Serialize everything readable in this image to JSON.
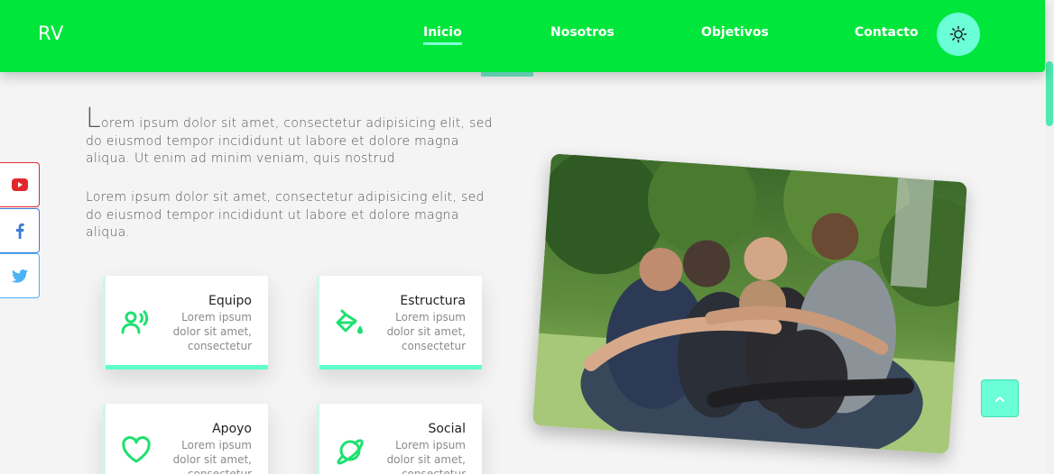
{
  "header": {
    "logo": "RV",
    "nav": [
      {
        "label": "Inicio",
        "active": true
      },
      {
        "label": "Nosotros",
        "active": false
      },
      {
        "label": "Objetivos",
        "active": false
      },
      {
        "label": "Contacto",
        "active": false
      }
    ],
    "theme_toggle_icon": "sun-icon"
  },
  "social": [
    {
      "icon": "youtube-icon",
      "color": "#e2282c"
    },
    {
      "icon": "facebook-icon",
      "color": "#3b7bd6"
    },
    {
      "icon": "twitter-icon",
      "color": "#4ab3f4"
    }
  ],
  "intro": {
    "dropcap": "L",
    "paragraph1_rest": "orem ipsum dolor sit amet, consectetur adipisicing elit, sed do eiusmod tempor incididunt ut labore et dolore magna aliqua. Ut enim ad minim veniam, quis nostrud",
    "paragraph2": "Lorem ipsum dolor sit amet, consectetur adipisicing elit, sed do eiusmod tempor incididunt ut labore et dolore magna aliqua."
  },
  "cards": [
    {
      "title": "Equipo",
      "desc": "Lorem ipsum dolor sit amet, consectetur",
      "icon": "team-icon"
    },
    {
      "title": "Estructura",
      "desc": "Lorem ipsum dolor sit amet, consectetur",
      "icon": "paint-bucket-icon"
    },
    {
      "title": "Apoyo",
      "desc": "Lorem ipsum dolor sit amet, consectetur",
      "icon": "heart-icon"
    },
    {
      "title": "Social",
      "desc": "Lorem ipsum dolor sit amet, consectetur",
      "icon": "planet-icon"
    }
  ],
  "colors": {
    "brand": "#00e63b",
    "accent": "#6affd6",
    "icon": "#1fe070"
  },
  "back_to_top_icon": "chevron-up-icon"
}
